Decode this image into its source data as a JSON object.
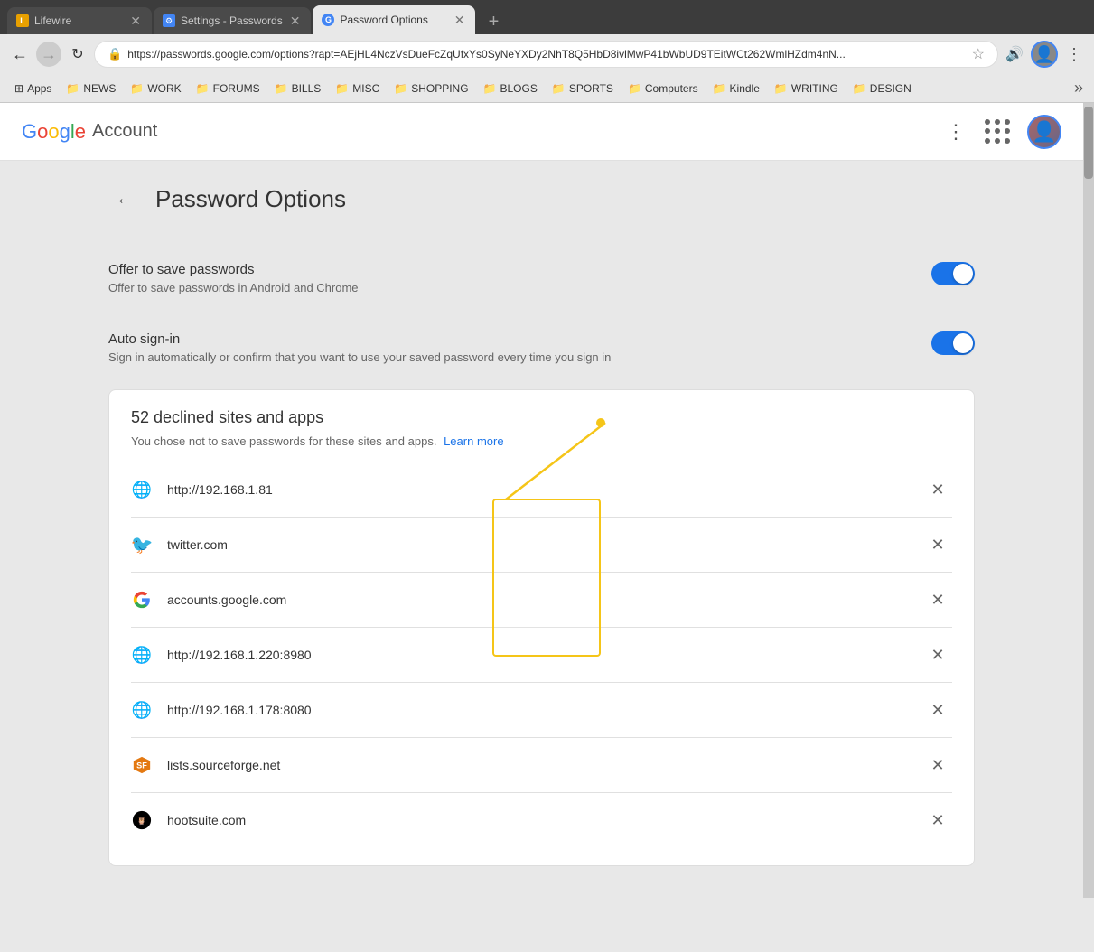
{
  "browser": {
    "tabs": [
      {
        "id": "lifewire",
        "favicon_color": "#e8a000",
        "favicon_letter": "L",
        "title": "Lifewire",
        "active": false
      },
      {
        "id": "settings",
        "favicon_color": "#4285f4",
        "favicon_letter": "⚙",
        "title": "Settings - Passwords",
        "active": false
      },
      {
        "id": "password-options",
        "favicon_color": "#4285f4",
        "favicon_letter": "G",
        "title": "Password Options",
        "active": true
      }
    ],
    "url": "https://passwords.google.com/options?rapt=AEjHL4NczVsDueFcZqUfxYs0SyNeYXDy2NhT8Q5HbD8ivlMwP41bWbUD9TEitWCt262WmlHZdm4nN...",
    "nav_back_disabled": false,
    "nav_forward_disabled": true
  },
  "bookmarks": [
    {
      "id": "apps",
      "icon": "⊞",
      "label": "Apps"
    },
    {
      "id": "news",
      "icon": "📁",
      "label": "NEWS"
    },
    {
      "id": "work",
      "icon": "📁",
      "label": "WORK"
    },
    {
      "id": "forums",
      "icon": "📁",
      "label": "FORUMS"
    },
    {
      "id": "bills",
      "icon": "📁",
      "label": "BILLS"
    },
    {
      "id": "misc",
      "icon": "📁",
      "label": "MISC"
    },
    {
      "id": "shopping",
      "icon": "📁",
      "label": "SHOPPING"
    },
    {
      "id": "blogs",
      "icon": "📁",
      "label": "BLOGS"
    },
    {
      "id": "sports",
      "icon": "📁",
      "label": "SPORTS"
    },
    {
      "id": "computers",
      "icon": "📁",
      "label": "Computers"
    },
    {
      "id": "kindle",
      "icon": "📁",
      "label": "Kindle"
    },
    {
      "id": "writing",
      "icon": "📁",
      "label": "WRITING"
    },
    {
      "id": "design",
      "icon": "📁",
      "label": "DESIGN"
    }
  ],
  "header": {
    "google_label": "Google",
    "account_label": "Account"
  },
  "page": {
    "title": "Password Options",
    "back_label": "←",
    "settings": [
      {
        "id": "offer-save",
        "title": "Offer to save passwords",
        "description": "Offer to save passwords in Android and Chrome",
        "enabled": true
      },
      {
        "id": "auto-signin",
        "title": "Auto sign-in",
        "description": "Sign in automatically or confirm that you want to use your saved password every time you sign in",
        "enabled": true
      }
    ],
    "declined": {
      "title": "52 declined sites and apps",
      "count": 52,
      "description": "You chose not to save passwords for these sites and apps.",
      "learn_more_label": "Learn more",
      "sites": [
        {
          "id": "site1",
          "name": "http://192.168.1.81",
          "icon_type": "globe"
        },
        {
          "id": "site2",
          "name": "twitter.com",
          "icon_type": "twitter"
        },
        {
          "id": "site3",
          "name": "accounts.google.com",
          "icon_type": "google"
        },
        {
          "id": "site4",
          "name": "http://192.168.1.220:8980",
          "icon_type": "globe"
        },
        {
          "id": "site5",
          "name": "http://192.168.1.178:8080",
          "icon_type": "globe"
        },
        {
          "id": "site6",
          "name": "lists.sourceforge.net",
          "icon_type": "sourceforge"
        },
        {
          "id": "site7",
          "name": "hootsuite.com",
          "icon_type": "hootsuite"
        }
      ]
    }
  }
}
